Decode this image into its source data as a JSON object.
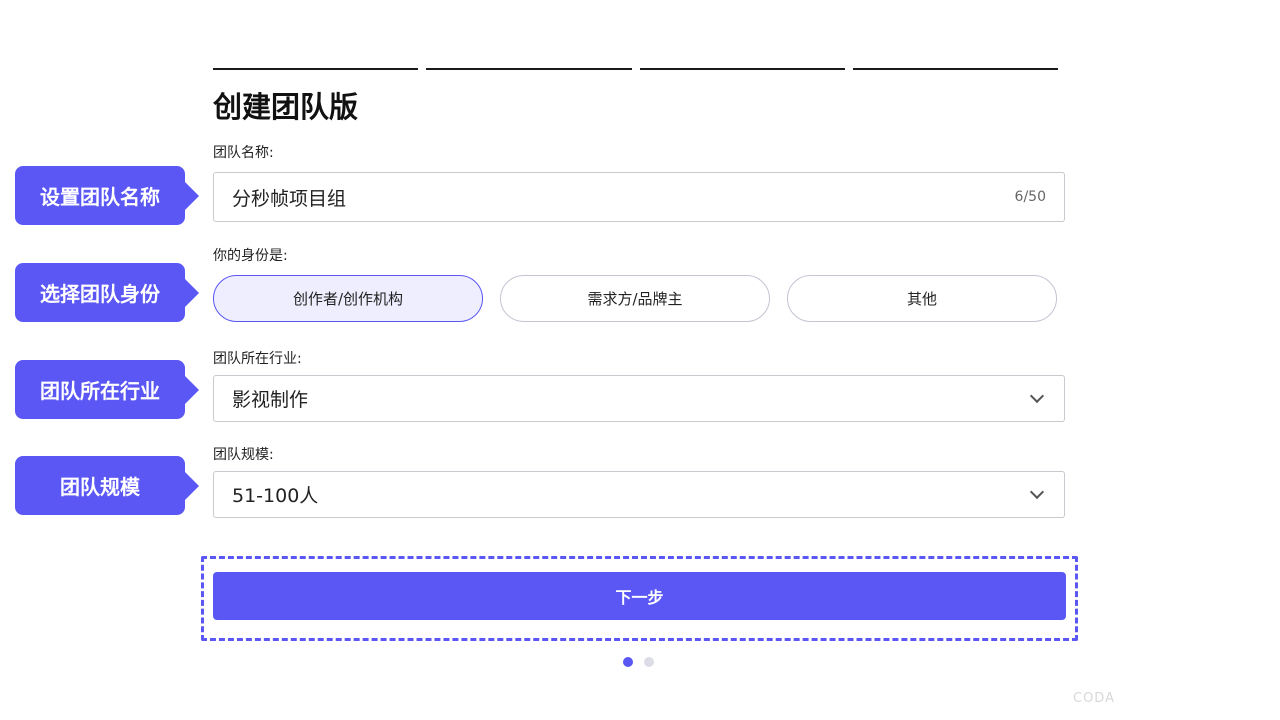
{
  "page_title": "创建团队版",
  "team_name": {
    "label": "团队名称:",
    "value": "分秒帧项目组",
    "counter": "6/50"
  },
  "identity": {
    "label": "你的身份是:",
    "options": [
      "创作者/创作机构",
      "需求方/品牌主",
      "其他"
    ],
    "selected_index": 0
  },
  "industry": {
    "label": "团队所在行业:",
    "value": "影视制作"
  },
  "size": {
    "label": "团队规模:",
    "value": "51-100人"
  },
  "callouts": [
    "设置团队名称",
    "选择团队身份",
    "团队所在行业",
    "团队规模"
  ],
  "next_button": "下一步",
  "pagination": {
    "total": 2,
    "current": 1
  },
  "watermark": "CODA",
  "colors": {
    "accent": "#5b57f5",
    "selected_bg": "#eeeefe"
  },
  "icons": [
    "chevron-down-icon"
  ]
}
